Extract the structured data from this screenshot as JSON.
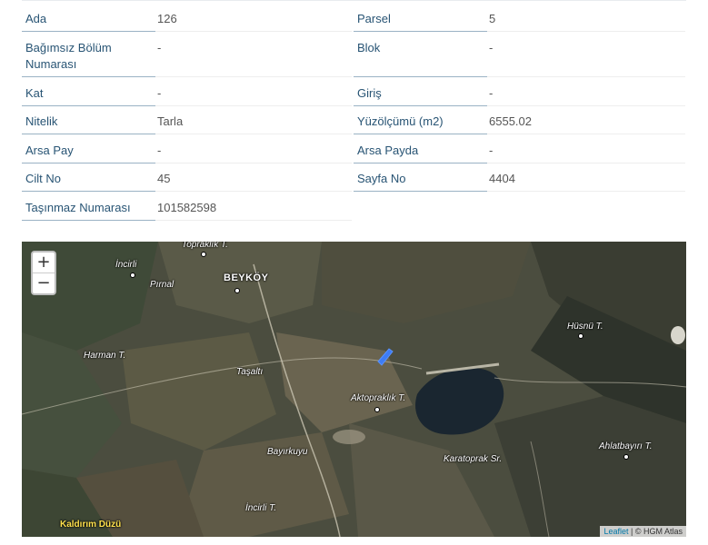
{
  "fields": [
    {
      "label": "Ada",
      "value": "126"
    },
    {
      "label": "Parsel",
      "value": "5"
    },
    {
      "label": "Bağımsız Bölüm Numarası",
      "value": "-"
    },
    {
      "label": "Blok",
      "value": "-"
    },
    {
      "label": "Kat",
      "value": "-"
    },
    {
      "label": "Giriş",
      "value": "-"
    },
    {
      "label": "Nitelik",
      "value": "Tarla"
    },
    {
      "label": "Yüzölçümü (m2)",
      "value": "6555.02"
    },
    {
      "label": "Arsa Pay",
      "value": "-"
    },
    {
      "label": "Arsa Payda",
      "value": "-"
    },
    {
      "label": "Cilt No",
      "value": "45"
    },
    {
      "label": "Sayfa No",
      "value": "4404"
    },
    {
      "label": "Taşınmaz Numarası",
      "value": "101582598"
    }
  ],
  "map": {
    "zoom_in": "+",
    "zoom_out": "−",
    "places": {
      "topraklik": "Topraklık T.",
      "incirli": "İncirli",
      "pirnal": "Pırnal",
      "beykoy": "BEYKÖY",
      "harman": "Harman T.",
      "tasalti": "Taşaltı",
      "aktopraklik": "Aktopraklık T.",
      "husnu": "Hüsnü T.",
      "bayirkuyu": "Bayırkuyu",
      "karatoprak": "Karatoprak Sr.",
      "ahlatbayiri": "Ahlatbayırı T.",
      "incirli_t": "İncirli T.",
      "kaldirim": "Kaldırım Düzü"
    },
    "attribution_link": "Leaflet",
    "attribution_text": "| © HGM Atlas",
    "parcel_color": "#3d7cf5",
    "lake_color": "#1a2630"
  }
}
